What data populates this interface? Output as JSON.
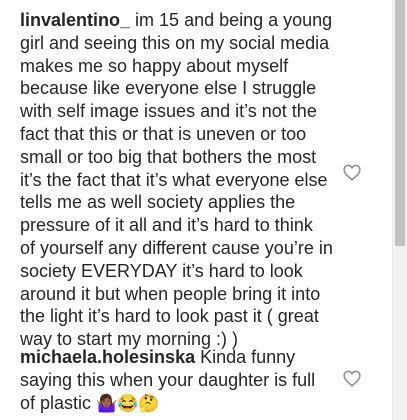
{
  "comments": [
    {
      "username": "linvalentino_",
      "text": "im 15 and being a young\ngirl and seeing this on my social media\nmakes me so happy about myself\nbecause like everyone else I struggle\nwith self image issues and it’s not the\nfact that this or that is uneven or too\nsmall or too big that bothers the most\nit’s the fact that it’s what everyone else\ntells me as well society applies the\npressure of it all and it’s hard to think\nof yourself any different cause you’re in\nsociety EVERYDAY it’s hard to look\naround it but when people bring it into\nthe light it’s hard to look past it ( great\nway to start my morning :) )",
      "like_icon": "heart-outline-icon"
    },
    {
      "username": "michaela.holesinska",
      "text": "Kinda funny\nsaying this when your daughter is full\nof plastic ",
      "emojis": "🤷🏾‍♀️😂🤔",
      "like_icon": "heart-outline-icon"
    }
  ],
  "colors": {
    "text": "#262626",
    "heart_stroke": "#8e8e8e",
    "scrollbar_track": "#f1f1f1",
    "scrollbar_thumb": "#c1c1c1"
  }
}
